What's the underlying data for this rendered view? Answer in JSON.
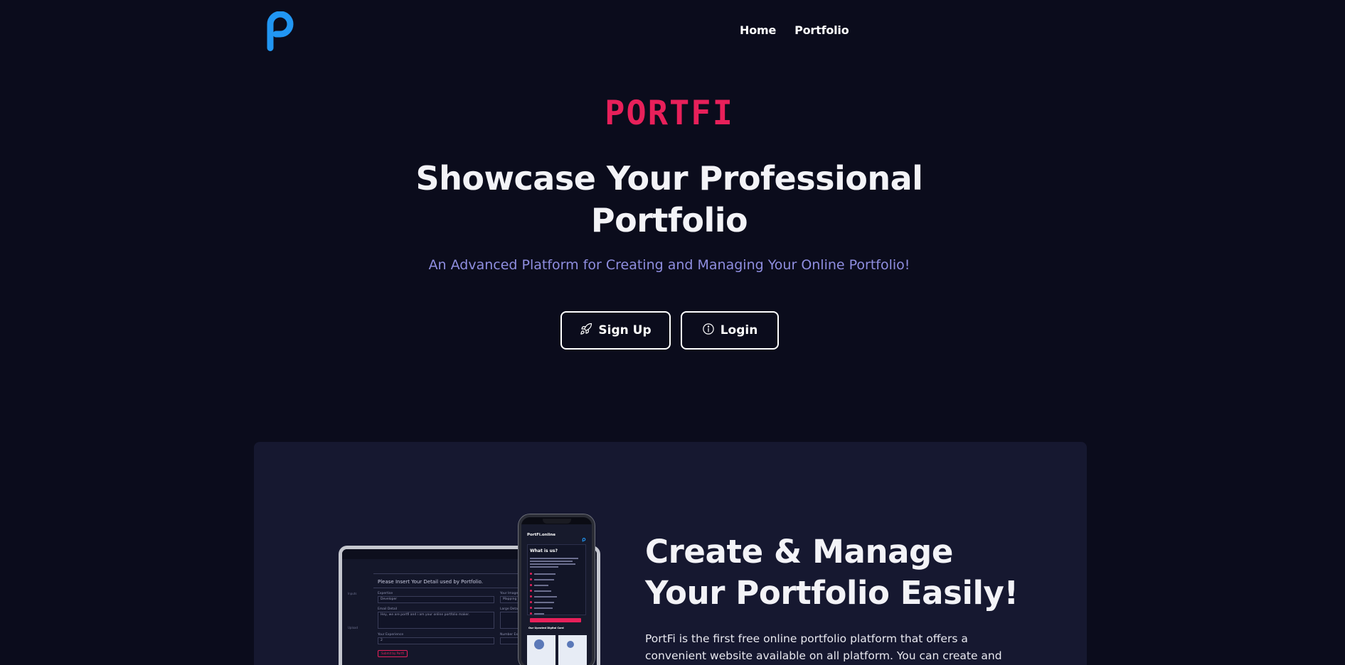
{
  "nav": {
    "logo_alt": "P",
    "links": [
      {
        "label": "Home"
      },
      {
        "label": "Portfolio"
      }
    ]
  },
  "hero": {
    "brand": "PORTFI",
    "title": "Showcase Your Professional Portfolio",
    "subtitle": "An Advanced Platform for Creating and Managing Your Online Portfolio!",
    "buttons": {
      "signup": "Sign Up",
      "login": "Login"
    }
  },
  "feature": {
    "title": "Create & Manage Your Portfolio Easily!",
    "text": "PortFi is the first free online portfolio platform that offers a convenient website available on all platform. You can create and manage your"
  },
  "mockup": {
    "laptop": {
      "heading": "Please Insert Your Detail used by Portfolio.",
      "expertise_label": "Expertise",
      "expertise_value": "Developer",
      "email_label": "Email Detail",
      "email_value": "Hey, we are portfi and i am your online portfolio maker.",
      "experience_label": "Your Experience",
      "experience_value": "2",
      "your_image_label": "Your Image",
      "your_image_value": "Mapping the",
      "large_detail_label": "Large Detail",
      "number_label": "Number Exp",
      "submit_label": "Submit by Portfi",
      "side_items": [
        "Inputs",
        "Upload"
      ]
    },
    "phone": {
      "app_title": "PortFi.online",
      "heading": "What is us?",
      "footer": "Our Upvoted Digital Card",
      "icon_color": "#2196f3"
    }
  },
  "colors": {
    "background": "#0b0c1c",
    "card": "#161830",
    "brand": "#e8205a",
    "subtitle": "#8f8ee0",
    "logo": "#2196f3"
  },
  "icons": {
    "logo": "portfi-p-logo",
    "signup": "rocket-icon",
    "login": "info-circle-icon"
  }
}
